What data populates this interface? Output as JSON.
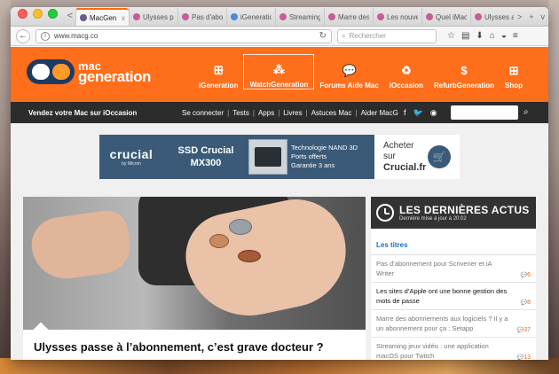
{
  "browser": {
    "tabs": [
      {
        "label": "MacGen",
        "color": "#6a5a8a",
        "active": true
      },
      {
        "label": "Ulysses pa",
        "color": "#c85b9a",
        "active": false
      },
      {
        "label": "Pas d'abonn",
        "color": "#c85b9a",
        "active": false
      },
      {
        "label": "iGeneration",
        "color": "#4a8bd6",
        "active": false
      },
      {
        "label": "Streaming",
        "color": "#c85b9a",
        "active": false
      },
      {
        "label": "Marre des a",
        "color": "#c85b9a",
        "active": false
      },
      {
        "label": "Les nouvea",
        "color": "#c85b9a",
        "active": false
      },
      {
        "label": "Quel iMac",
        "color": "#c85b9a",
        "active": false
      },
      {
        "label": "Ulysses a",
        "color": "#c85b9a",
        "active": false
      }
    ],
    "url": "www.macg.co",
    "search_placeholder": "Rechercher",
    "tab_close_glyph": "x",
    "nav_left_glyph": "<",
    "nav_right_glyph": ">",
    "new_tab_glyph": "+",
    "dropdown_glyph": "v"
  },
  "site": {
    "logo": {
      "line1": "mac",
      "line2": "generation"
    },
    "nav": [
      {
        "label": "iGeneration",
        "icon": "ii-icon",
        "glyph": "ꕥ",
        "selected": false
      },
      {
        "label": "WatchGeneration",
        "icon": "dotgrid-icon",
        "glyph": "⁂",
        "selected": true
      },
      {
        "label": "Forums Aide Mac",
        "icon": "chat-bubble-icon",
        "glyph": "💬",
        "selected": false
      },
      {
        "label": "iOccasion",
        "icon": "hands-icon",
        "glyph": "♻",
        "selected": false
      },
      {
        "label": "RefurbGeneration",
        "icon": "laptop-dollar-icon",
        "glyph": "$",
        "selected": false
      },
      {
        "label": "Shop",
        "icon": "basket-icon",
        "glyph": "⊞",
        "selected": false
      }
    ],
    "subbar": {
      "promo": "Vendez votre Mac sur iOccasion",
      "links": [
        "Se connecter",
        "Tests",
        "Apps",
        "Livres",
        "Astuces Mac",
        "Aider MacG"
      ]
    },
    "banner": {
      "brand": "crucial",
      "brand_sub": "by Micron",
      "product_line1": "SSD Crucial",
      "product_line2": "MX300",
      "features": [
        "Technologie NAND 3D",
        "Ports offerts",
        "Garantie 3 ans"
      ],
      "cta_line1": "Acheter sur",
      "cta_line2": "Crucial.fr",
      "brand_color": "#3a5a78"
    },
    "hero": {
      "title": "Ulysses passe à l’abonnement, c’est grave docteur ?"
    },
    "sidebar": {
      "title": "LES DERNIÈRES ACTUS",
      "subtitle": "Dernière mise à jour à 20:02",
      "tab": "Les titres",
      "items": [
        {
          "title": "Pas d’abonnement pour Scrivener et iA Writer",
          "comments": "6",
          "read": true
        },
        {
          "title": "Les sites d’Apple ont une bonne gestion des mots de passe",
          "comments": "8",
          "read": false
        },
        {
          "title": "Marre des abonnements aux logiciels ? Il y a un abonnement pour ça : Setapp",
          "comments": "37",
          "read": true
        },
        {
          "title": "Streaming jeux vidéo : une application macOS pour Twitch",
          "comments": "13",
          "read": true
        }
      ]
    },
    "accent_color": "#ff6e1a"
  }
}
